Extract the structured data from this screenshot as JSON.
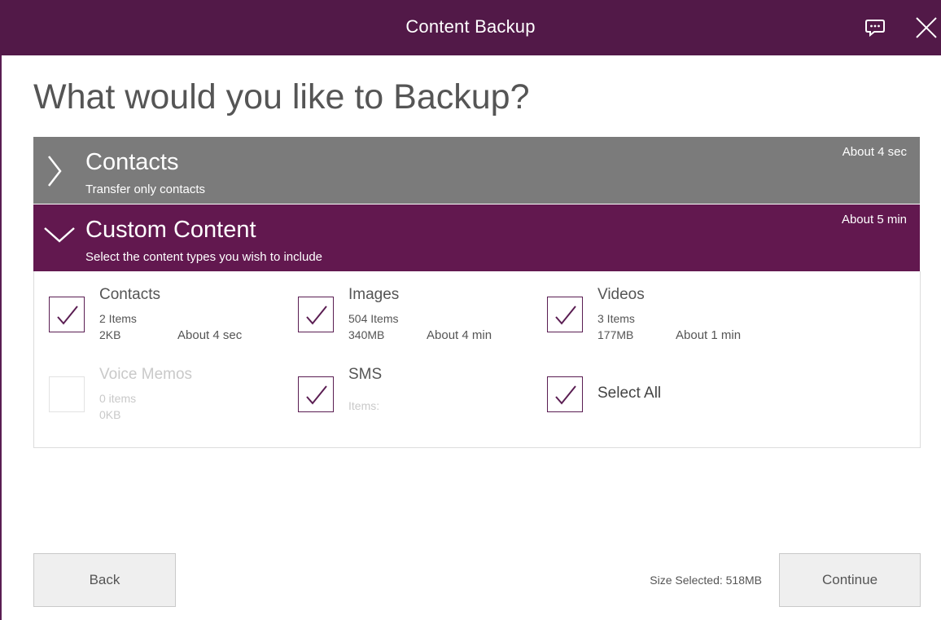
{
  "window": {
    "title": "Content Backup",
    "accent": "#521948",
    "icons": {
      "feedback": "feedback-icon",
      "close": "close-icon"
    }
  },
  "heading": "What would you like to Backup?",
  "sections": {
    "contacts": {
      "title": "Contacts",
      "subtitle": "Transfer only contacts",
      "time": "About 4 sec",
      "color": "#7b7b7b",
      "expanded": false
    },
    "custom": {
      "title": "Custom Content",
      "subtitle": "Select the content types you wish to include",
      "time": "About 5 min",
      "color": "#62184f",
      "expanded": true
    }
  },
  "items": {
    "contacts": {
      "name": "Contacts",
      "count": "2 Items",
      "size": "2KB",
      "time": "About 4 sec",
      "checked": true,
      "enabled": true
    },
    "images": {
      "name": "Images",
      "count": "504 Items",
      "size": "340MB",
      "time": "About 4 min",
      "checked": true,
      "enabled": true
    },
    "videos": {
      "name": "Videos",
      "count": "3 Items",
      "size": "177MB",
      "time": "About 1 min",
      "checked": true,
      "enabled": true
    },
    "voice_memos": {
      "name": "Voice Memos",
      "count": "0 items",
      "size": "0KB",
      "checked": false,
      "enabled": false
    },
    "sms": {
      "name": "SMS",
      "count": "Items:",
      "checked": true,
      "enabled": true
    },
    "select_all": {
      "name": "Select All",
      "checked": true,
      "enabled": true
    }
  },
  "footer": {
    "back_label": "Back",
    "size_selected": "Size Selected: 518MB",
    "continue_label": "Continue"
  }
}
